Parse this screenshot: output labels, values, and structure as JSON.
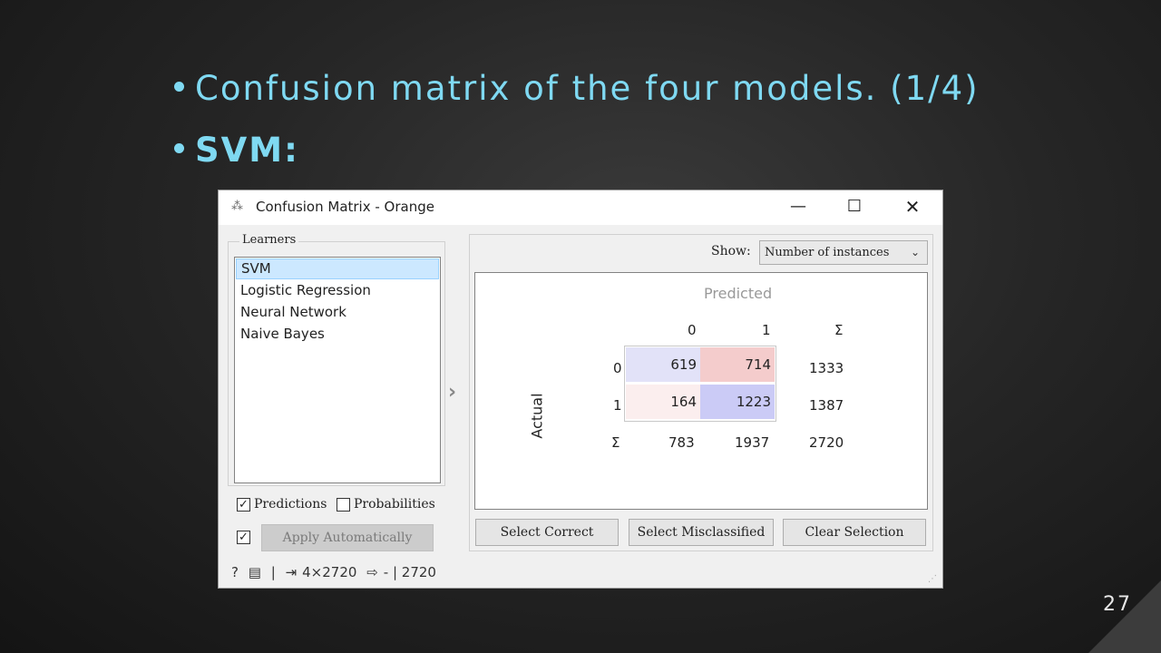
{
  "slide": {
    "bullet1": "Confusion matrix of the four models. (1/4)",
    "bullet2": "SVM:",
    "page_number": "27",
    "accent_color": "#7fd9f2"
  },
  "window": {
    "title": "Confusion Matrix - Orange",
    "controls": {
      "minimize": "—",
      "maximize": "☐",
      "close": "✕"
    }
  },
  "learners": {
    "legend": "Learners",
    "items": [
      "SVM",
      "Logistic Regression",
      "Neural Network",
      "Naive Bayes"
    ],
    "selected": "SVM"
  },
  "options": {
    "predictions_label": "Predictions",
    "predictions_checked": true,
    "probabilities_label": "Probabilities",
    "probabilities_checked": false,
    "auto_checked": true,
    "apply_label": "Apply Automatically"
  },
  "show": {
    "label": "Show:",
    "value": "Number of instances"
  },
  "matrix": {
    "predicted_label": "Predicted",
    "actual_label": "Actual",
    "col_headers": [
      "0",
      "1",
      "Σ"
    ],
    "row_headers": [
      "0",
      "1",
      "Σ"
    ],
    "cells": [
      [
        "619",
        "714"
      ],
      [
        "164",
        "1223"
      ]
    ],
    "row_totals": [
      "1333",
      "1387"
    ],
    "col_totals": [
      "783",
      "1937",
      "2720"
    ],
    "cell_colors": [
      [
        "#e2e2f8",
        "#f4cccc"
      ],
      [
        "#fbeeee",
        "#cbcbf6"
      ]
    ]
  },
  "buttons": {
    "select_correct": "Select Correct",
    "select_misclassified": "Select Misclassified",
    "clear_selection": "Clear Selection"
  },
  "status": {
    "input_summary": "4×2720",
    "output_summary": "- | 2720"
  }
}
